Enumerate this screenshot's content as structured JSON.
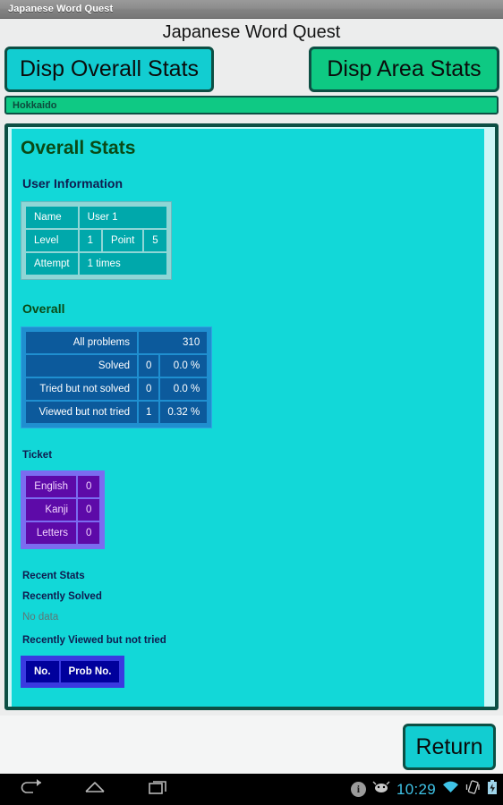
{
  "window": {
    "title": "Japanese Word Quest"
  },
  "header": {
    "app_title": "Japanese Word Quest"
  },
  "toolbar": {
    "disp_overall_label": "Disp Overall Stats",
    "disp_area_label": "Disp Area Stats"
  },
  "area_spinner": {
    "selected": "Hokkaido"
  },
  "content": {
    "page_title": "Overall Stats",
    "user_info": {
      "heading": "User Information",
      "rows": [
        {
          "key": "Name",
          "value": "User 1"
        },
        {
          "key": "Level",
          "value": "1",
          "key2": "Point",
          "value2": "5"
        },
        {
          "key": "Attempt",
          "value": "1 times"
        }
      ]
    },
    "overall": {
      "heading": "Overall",
      "rows": [
        {
          "name": "All problems",
          "count": "",
          "pct": "310"
        },
        {
          "name": "Solved",
          "count": "0",
          "pct": "0.0 %"
        },
        {
          "name": "Tried but not solved",
          "count": "0",
          "pct": "0.0 %"
        },
        {
          "name": "Viewed but not tried",
          "count": "1",
          "pct": "0.32 %"
        }
      ]
    },
    "ticket": {
      "heading": "Ticket",
      "rows": [
        {
          "name": "English",
          "count": "0"
        },
        {
          "name": "Kanji",
          "count": "0"
        },
        {
          "name": "Letters",
          "count": "0"
        }
      ]
    },
    "recent": {
      "heading": "Recent Stats",
      "solved_label": "Recently Solved",
      "solved_empty": "No data",
      "viewed_label": "Recently Viewed but not tried",
      "viewed_columns": [
        "No.",
        "Prob No."
      ]
    }
  },
  "footer": {
    "return_label": "Return"
  },
  "statusbar": {
    "time": "10:29",
    "icons": [
      "info-icon",
      "android-debug-icon",
      "wifi-icon",
      "vibrate-icon",
      "battery-icon"
    ]
  },
  "navbar": {
    "icons": [
      "back-icon",
      "home-icon",
      "recents-icon"
    ]
  },
  "colors": {
    "accent_cyan": "#12cdd1",
    "accent_green": "#0ec983",
    "border_dark_teal": "#0d4f44",
    "panel_bg": "#12d8d8",
    "table_blue": "#0c5a9c",
    "table_purple": "#5d0aa8",
    "table_navy": "#00009c",
    "status_time": "#3fc4e8"
  }
}
